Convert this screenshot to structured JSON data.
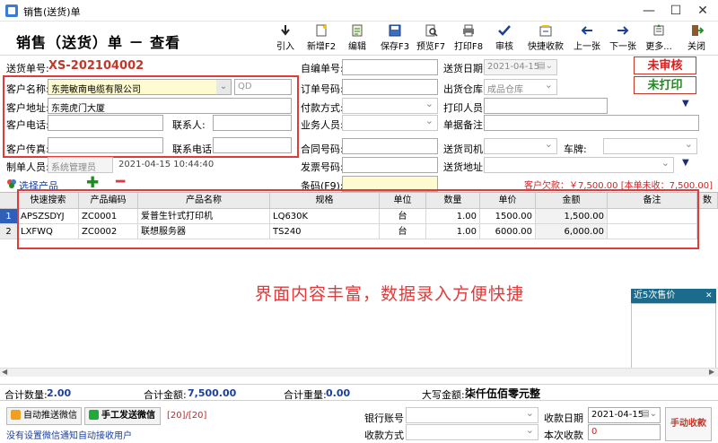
{
  "window": {
    "title": "销售(送货)单"
  },
  "header": {
    "title": "销售（送货）单 － 查看"
  },
  "toolbar": {
    "import": "引入",
    "new": "新增F2",
    "edit": "编辑",
    "save": "保存F3",
    "preview": "预览F7",
    "print": "打印F8",
    "audit": "审核",
    "quick_pay": "快捷收款",
    "prev": "上一张",
    "next": "下一张",
    "more": "更多...",
    "close": "关闭"
  },
  "form": {
    "order_no_label": "送货单号:",
    "order_no": "XS-202104002",
    "self_no_label": "自编单号:",
    "self_no": "",
    "delivery_date_label": "送货日期:",
    "delivery_date": "2021-04-15",
    "customer_label": "客户名称:",
    "customer": "东莞敏南电缆有限公司",
    "customer_code": "QD",
    "order_code_label": "订单号码:",
    "order_code": "",
    "warehouse_label": "出货仓库:",
    "warehouse": "成品仓库",
    "address_label": "客户地址:",
    "address": "东莞虎门大厦",
    "payment_label": "付款方式:",
    "payment": "",
    "printer_label": "打印人员:",
    "printer": "",
    "phone_label": "客户电话:",
    "phone": "",
    "contact_label": "联系人:",
    "contact": "",
    "sales_label": "业务人员:",
    "sales": "",
    "remark_label": "单据备注:",
    "remark": "",
    "fax_label": "客户传真:",
    "fax": "",
    "contact_phone_label": "联系电话:",
    "contact_phone": "",
    "contract_label": "合同号码:",
    "contract": "",
    "driver_label": "送货司机:",
    "driver": "",
    "plate_label": "车牌:",
    "plate": "",
    "creator_label": "制单人员:",
    "creator": "系统管理员",
    "created_at": "2021-04-15 10:44:40",
    "invoice_label": "发票号码:",
    "invoice": "",
    "ship_addr_label": "送货地址:",
    "ship_addr": "",
    "barcode_label": "条码(F9):",
    "barcode": "",
    "select_product": "选择产品",
    "debt_text": "客户欠款：￥7,500.00 [本单未收：7,500.00]"
  },
  "status": {
    "unaudited": "未审核",
    "unprinted": "未打印"
  },
  "table": {
    "headers": [
      "快速搜索",
      "产品编码",
      "产品名称",
      "规格",
      "单位",
      "数量",
      "单价",
      "金额",
      "备注",
      "数"
    ],
    "rows": [
      {
        "idx": "1",
        "search": "APSZSDYJ",
        "code": "ZC0001",
        "name": "爱普生针式打印机",
        "spec": "LQ630K",
        "unit": "台",
        "qty": "1.00",
        "price": "1500.00",
        "amount": "1,500.00",
        "note": ""
      },
      {
        "idx": "2",
        "search": "LXFWQ",
        "code": "ZC0002",
        "name": "联想服务器",
        "spec": "TS240",
        "unit": "台",
        "qty": "1.00",
        "price": "6000.00",
        "amount": "6,000.00",
        "note": ""
      }
    ]
  },
  "overlay": {
    "promo": "界面内容丰富，数据录入方便快捷",
    "recent_price": "近5次售价"
  },
  "totals": {
    "qty_label": "合计数量:",
    "qty": "2.00",
    "amount_label": "合计金额:",
    "amount": "7,500.00",
    "weight_label": "合计重量:",
    "weight": "0.00",
    "upper_label": "大写金额:",
    "upper": "柒仟伍佰零元整"
  },
  "bottom": {
    "auto_wechat": "自动推送微信",
    "manual_wechat": "手工发送微信",
    "count": "[20]/[20]",
    "notice": "没有设置微信通知自动接收用户",
    "bank_label": "银行账号",
    "bank": "",
    "pay_date_label": "收款日期",
    "pay_date": "2021-04-15",
    "method_label": "收款方式",
    "method": "",
    "this_pay_label": "本次收款",
    "this_pay": "0",
    "manual_pay": "手动收款"
  },
  "colors": {
    "red": "#e03a3a",
    "green": "#1f8a1f",
    "blue": "#1a3f9c",
    "highlight": "#fffbd0"
  }
}
